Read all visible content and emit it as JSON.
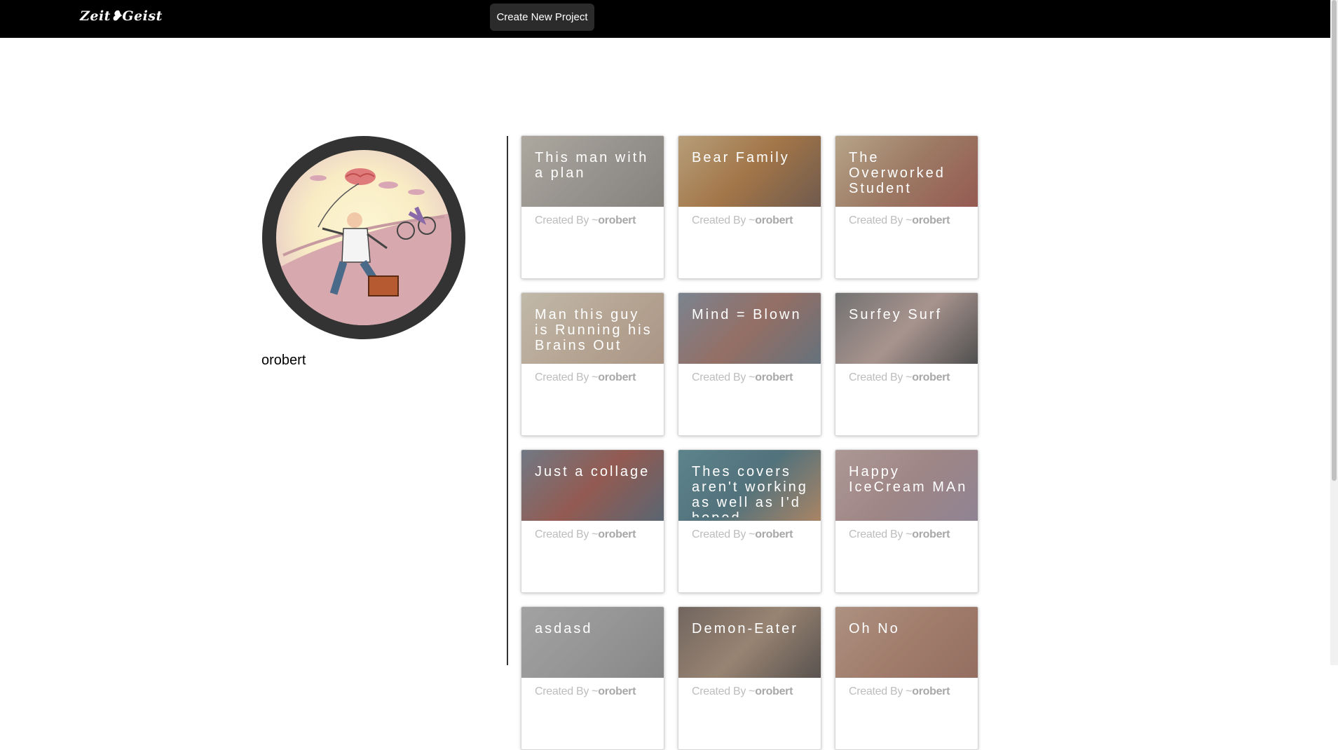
{
  "header": {
    "logo": "Zeit❥Geist",
    "create_button": "Create New Project"
  },
  "profile": {
    "username": "orobert"
  },
  "card_credit_prefix": "Created By ~",
  "projects": [
    {
      "title": "This man with a plan",
      "author": "orobert",
      "cover": [
        "#c9c2b4",
        "#a8a29a",
        "#8d8880"
      ]
    },
    {
      "title": "Bear Family",
      "author": "orobert",
      "cover": [
        "#d8b37a",
        "#b9742f",
        "#6b4b38"
      ]
    },
    {
      "title": "The Overworked Student",
      "author": "orobert",
      "cover": [
        "#d8bb93",
        "#b07b5a",
        "#a54a3e"
      ]
    },
    {
      "title": "Man this guy is Running his Brains Out",
      "author": "orobert",
      "cover": [
        "#e8dcc4",
        "#d8bea3",
        "#c6a58d"
      ]
    },
    {
      "title": "Mind = Blown",
      "author": "orobert",
      "cover": [
        "#7c8a9c",
        "#a46a5b",
        "#5c6f7f"
      ]
    },
    {
      "title": "Surfey Surf",
      "author": "orobert",
      "cover": [
        "#6f6f6f",
        "#c2a39a",
        "#3a3a3a"
      ]
    },
    {
      "title": "Just a collage",
      "author": "orobert",
      "cover": [
        "#6d7a8b",
        "#a14b3d",
        "#4b5c6f"
      ]
    },
    {
      "title": "Thes covers aren't working as well as I'd hoped",
      "author": "orobert",
      "cover": [
        "#4f8a96",
        "#3e6f7e",
        "#c48b5b"
      ]
    },
    {
      "title": "Happy IceCream MAn",
      "author": "orobert",
      "cover": [
        "#c9a9a4",
        "#b48e8e",
        "#9c8aa1"
      ]
    },
    {
      "title": "asdasd",
      "author": "orobert",
      "cover": [
        "#b9b9b9",
        "#a6a6a6",
        "#8f8f8f"
      ]
    },
    {
      "title": "Demon-Eater",
      "author": "orobert",
      "cover": [
        "#6e5c52",
        "#a98a6f",
        "#4a3f3a"
      ]
    },
    {
      "title": "Oh No",
      "author": "orobert",
      "cover": [
        "#c99f86",
        "#b77f66",
        "#a36a55"
      ]
    }
  ]
}
